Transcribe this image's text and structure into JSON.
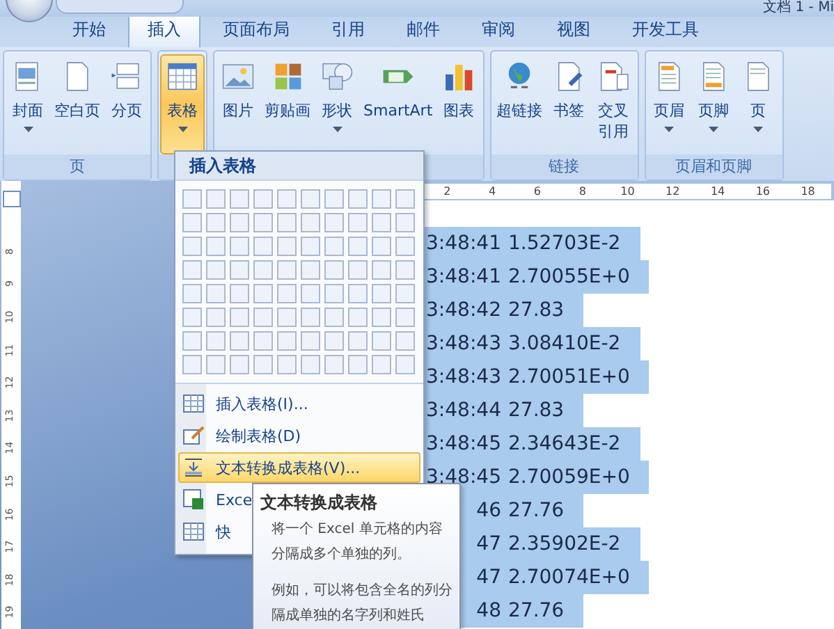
{
  "window": {
    "title": "文档 1 - Mi"
  },
  "tabs": [
    {
      "label": "开始",
      "selected": false
    },
    {
      "label": "插入",
      "selected": true
    },
    {
      "label": "页面布局",
      "selected": false
    },
    {
      "label": "引用",
      "selected": false
    },
    {
      "label": "邮件",
      "selected": false
    },
    {
      "label": "审阅",
      "selected": false
    },
    {
      "label": "视图",
      "selected": false
    },
    {
      "label": "开发工具",
      "selected": false
    }
  ],
  "ribbon": {
    "groups": [
      {
        "label": "页",
        "buttons": [
          {
            "label": "封面",
            "dropdown": true,
            "pressed": false
          },
          {
            "label": "空白页",
            "dropdown": false,
            "pressed": false
          },
          {
            "label": "分页",
            "dropdown": false,
            "pressed": false
          }
        ]
      },
      {
        "buttons": [
          {
            "label": "表格",
            "dropdown": true,
            "pressed": true
          }
        ]
      },
      {
        "buttons": [
          {
            "label": "图片",
            "dropdown": false,
            "pressed": false
          },
          {
            "label": "剪贴画",
            "dropdown": false,
            "pressed": false
          },
          {
            "label": "形状",
            "dropdown": true,
            "pressed": false
          },
          {
            "label": "SmartArt",
            "dropdown": false,
            "pressed": false
          },
          {
            "label": "图表",
            "dropdown": false,
            "pressed": false
          }
        ]
      },
      {
        "label": "链接",
        "buttons": [
          {
            "label": "超链接",
            "dropdown": false,
            "pressed": false
          },
          {
            "label": "书签",
            "dropdown": false,
            "pressed": false
          },
          {
            "label": "交叉引用",
            "dropdown": false,
            "pressed": false
          }
        ]
      },
      {
        "label": "页眉和页脚",
        "buttons": [
          {
            "label": "页眉",
            "dropdown": true,
            "pressed": false
          },
          {
            "label": "页脚",
            "dropdown": true,
            "pressed": false
          },
          {
            "label": "页",
            "dropdown": true,
            "pressed": false
          }
        ]
      }
    ]
  },
  "vertical_ruler": [
    "8",
    "9",
    "10",
    "11",
    "12",
    "13",
    "14",
    "15",
    "16",
    "17",
    "18",
    "19"
  ],
  "horizontal_ruler": [
    "2",
    "4",
    "6",
    "8",
    "10",
    "12",
    "14",
    "16",
    "18"
  ],
  "document_lines": [
    {
      "time": "3:48:41",
      "value": "1.52703E-2",
      "selected": true
    },
    {
      "time": "3:48:41",
      "value": "2.70055E+0",
      "selected": true
    },
    {
      "time": "3:48:42",
      "value": "27.83",
      "selected": true
    },
    {
      "time": "3:48:43",
      "value": "3.08410E-2",
      "selected": true
    },
    {
      "time": "3:48:43",
      "value": "2.70051E+0",
      "selected": true
    },
    {
      "time": "3:48:44",
      "value": "27.83",
      "selected": true
    },
    {
      "time": "3:48:45",
      "value": "2.34643E-2",
      "selected": true
    },
    {
      "time": "3:48:45",
      "value": "2.70059E+0",
      "selected": true
    },
    {
      "time": "46",
      "value": "27.76",
      "selected": true
    },
    {
      "time": "47",
      "value": "2.35902E-2",
      "selected": true
    },
    {
      "time": "47",
      "value": "2.70074E+0",
      "selected": true
    },
    {
      "time": "48",
      "value": "27.76",
      "selected": true
    }
  ],
  "table_menu": {
    "title": "插入表格",
    "items": [
      {
        "label": "插入表格(I)...",
        "selected": false
      },
      {
        "label": "绘制表格(D)",
        "selected": false
      },
      {
        "label": "文本转换成表格(V)...",
        "selected": true
      },
      {
        "label": "Exce",
        "selected": false
      },
      {
        "label": "快",
        "selected": false
      }
    ]
  },
  "tooltip": {
    "title": "文本转换成表格",
    "paragraphs": [
      "将一个 Excel 单元格的内容分隔成多个单独的列。",
      "例如，可以将包含全名的列分隔成单独的名字列和姓氏"
    ]
  }
}
